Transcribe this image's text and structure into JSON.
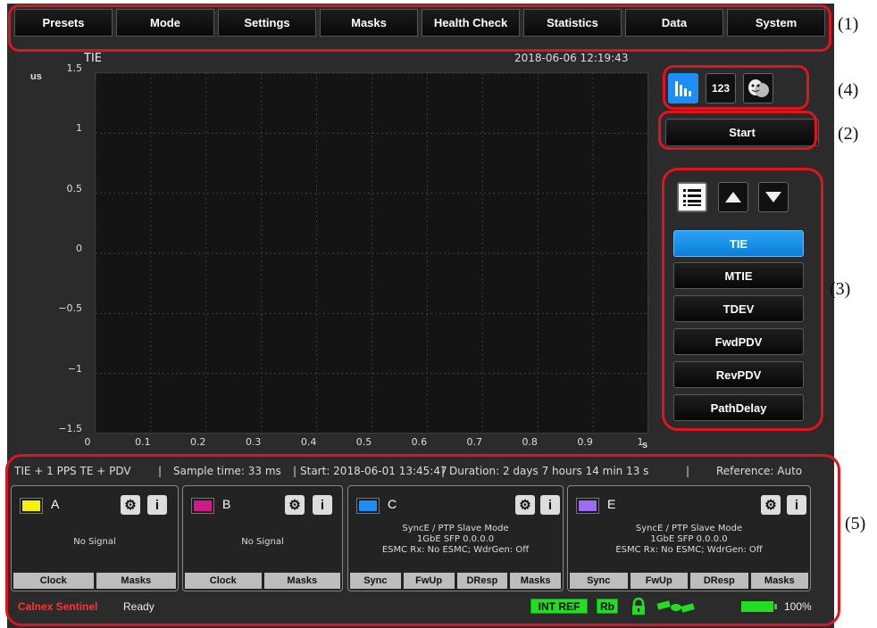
{
  "menu": [
    "Presets",
    "Mode",
    "Settings",
    "Masks",
    "Health Check",
    "Statistics",
    "Data",
    "System"
  ],
  "chart_data": {
    "type": "line",
    "title": "TIE",
    "timestamp": "2018-06-06 12:19:43",
    "ylabel": "us",
    "xlabel": "s",
    "ylim": [
      -1.5,
      1.5
    ],
    "xlim": [
      0,
      1
    ],
    "yticks": [
      "1.5",
      "1",
      "0.5",
      "0",
      "−0.5",
      "−1",
      "−1.5"
    ],
    "xticks": [
      "0",
      "0.1",
      "0.2",
      "0.3",
      "0.4",
      "0.5",
      "0.6",
      "0.7",
      "0.8",
      "0.9",
      "1"
    ],
    "grid": true,
    "series": []
  },
  "view_toggle": {
    "graph_icon": "bar-chart-icon",
    "numeric_label": "123",
    "theme_icon": "masks-icon"
  },
  "start_label": "Start",
  "measurements": [
    "TIE",
    "MTIE",
    "TDEV",
    "FwdPDV",
    "RevPDV",
    "PathDelay"
  ],
  "selected_measurement": "TIE",
  "status": {
    "mode": "TIE + 1 PPS TE + PDV",
    "sample_time": "Sample time: 33 ms",
    "start": "Start: 2018-06-01 13:45:47",
    "duration": "Duration: 2 days 7 hours 14 min 13 s",
    "reference": "Reference: Auto",
    "sep": "|"
  },
  "channels": [
    {
      "name": "A",
      "color": "#f4f400",
      "info": [
        "No Signal"
      ],
      "tabs": [
        "Clock",
        "Masks"
      ]
    },
    {
      "name": "B",
      "color": "#d01a8a",
      "info": [
        "No Signal"
      ],
      "tabs": [
        "Clock",
        "Masks"
      ]
    },
    {
      "name": "C",
      "color": "#1c8ef5",
      "info": [
        "SyncE / PTP Slave Mode",
        "1GbE SFP  0.0.0.0",
        "ESMC Rx: No ESMC; WdrGen: Off"
      ],
      "tabs": [
        "Sync",
        "FwUp",
        "DResp",
        "Masks"
      ]
    },
    {
      "name": "E",
      "color": "#9d6cf0",
      "info": [
        "SyncE / PTP Slave Mode",
        "1GbE SFP  0.0.0.0",
        "ESMC Rx: No ESMC; WdrGen: Off"
      ],
      "tabs": [
        "Sync",
        "FwUp",
        "DResp",
        "Masks"
      ]
    }
  ],
  "bottom": {
    "brand": "Calnex Sentinel",
    "state": "Ready",
    "int_ref": "INT REF",
    "rb": "Rb",
    "battery": "100%"
  },
  "callouts": [
    "(1)",
    "(2)",
    "(3)",
    "(4)",
    "(5)"
  ],
  "colors": {
    "accent": "#1c8ef5",
    "highlight": "#e0141e",
    "ok": "#22dd22"
  }
}
